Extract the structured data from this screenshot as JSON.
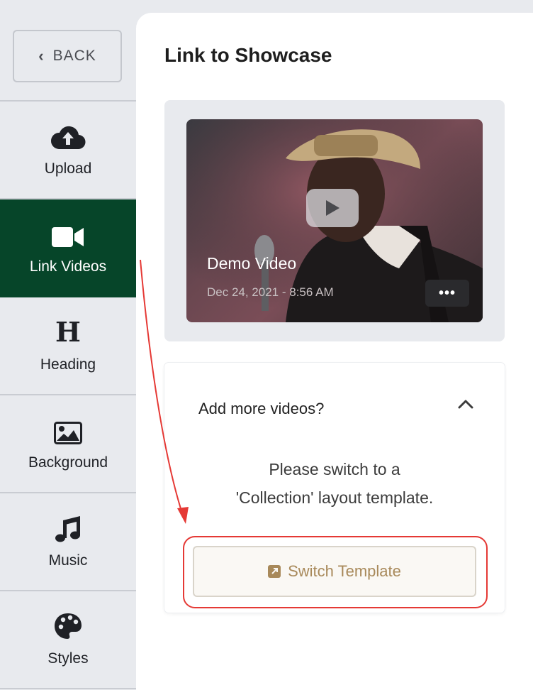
{
  "sidebar": {
    "back_label": "BACK",
    "items": [
      {
        "label": "Upload",
        "icon": "cloud-upload-icon"
      },
      {
        "label": "Link Videos",
        "icon": "video-camera-icon",
        "active": true
      },
      {
        "label": "Heading",
        "icon": "heading-icon"
      },
      {
        "label": "Background",
        "icon": "image-icon"
      },
      {
        "label": "Music",
        "icon": "music-note-icon"
      },
      {
        "label": "Styles",
        "icon": "palette-icon"
      }
    ],
    "heading_glyph": "H",
    "active_color": "#064529"
  },
  "main": {
    "title": "Link to Showcase",
    "video": {
      "title": "Demo Video",
      "date": "Dec 24, 2021 - 8:56 AM",
      "more_label": "•••"
    },
    "add_more": {
      "title": "Add more videos?",
      "message_line1": "Please switch to a",
      "message_line2": "'Collection' layout template.",
      "button_label": "Switch Template",
      "button_color": "#a8895a"
    }
  },
  "annotation_color": "#e53935"
}
